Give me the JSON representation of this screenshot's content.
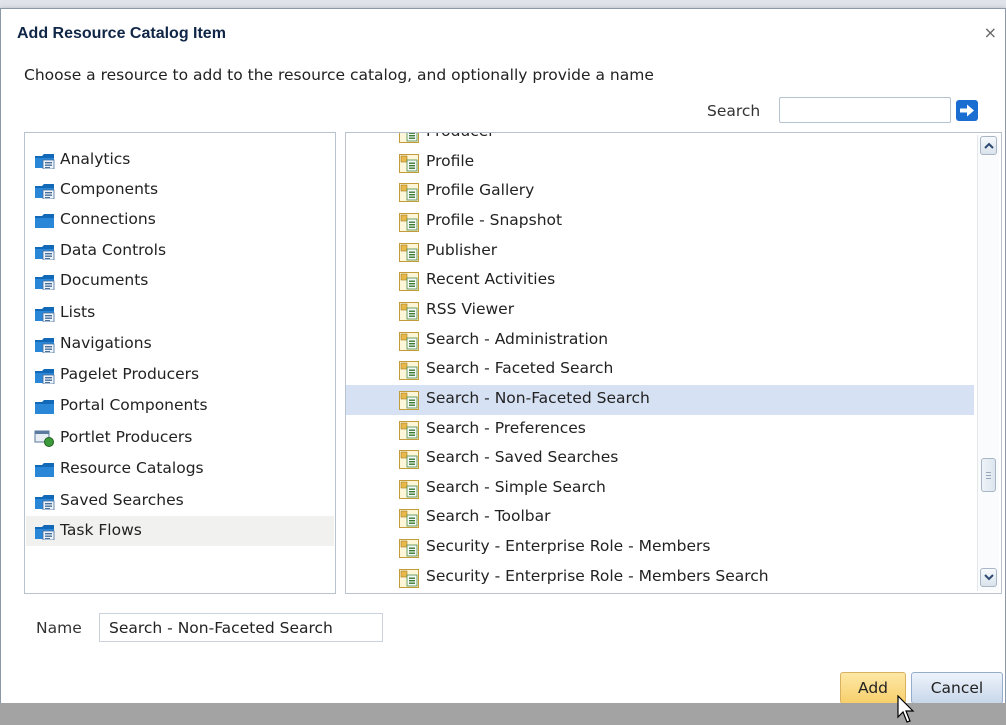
{
  "dialog": {
    "title": "Add Resource Catalog Item",
    "close_glyph": "×",
    "instructions": "Choose a resource to add to the resource catalog, and optionally provide a name"
  },
  "search": {
    "label": "Search",
    "value": "",
    "go_icon": "arrow-right-icon",
    "go_color": "#1a6dd1"
  },
  "folders": [
    {
      "label": "Analytics",
      "icon": "folder-analytics-icon",
      "selected": false
    },
    {
      "label": "Components",
      "icon": "folder-components-icon",
      "selected": false
    },
    {
      "label": "Connections",
      "icon": "folder-icon",
      "selected": false
    },
    {
      "label": "Data Controls",
      "icon": "folder-data-controls-icon",
      "selected": false
    },
    {
      "label": "Documents",
      "icon": "folder-documents-icon",
      "selected": false
    },
    {
      "label": "Lists",
      "icon": "folder-lists-icon",
      "selected": false
    },
    {
      "label": "Navigations",
      "icon": "folder-navigations-icon",
      "selected": false
    },
    {
      "label": "Pagelet Producers",
      "icon": "folder-pagelet-icon",
      "selected": false
    },
    {
      "label": "Portal Components",
      "icon": "folder-icon",
      "selected": false
    },
    {
      "label": "Portlet Producers",
      "icon": "portlet-producer-icon",
      "selected": false
    },
    {
      "label": "Resource Catalogs",
      "icon": "folder-icon",
      "selected": false
    },
    {
      "label": "Saved Searches",
      "icon": "folder-saved-searches-icon",
      "selected": false
    },
    {
      "label": "Task Flows",
      "icon": "folder-task-flows-icon",
      "selected": true
    }
  ],
  "resources": [
    {
      "label": "Producer",
      "selected": false
    },
    {
      "label": "Profile",
      "selected": false
    },
    {
      "label": "Profile Gallery",
      "selected": false
    },
    {
      "label": "Profile - Snapshot",
      "selected": false
    },
    {
      "label": "Publisher",
      "selected": false
    },
    {
      "label": "Recent Activities",
      "selected": false
    },
    {
      "label": "RSS Viewer",
      "selected": false
    },
    {
      "label": "Search - Administration",
      "selected": false
    },
    {
      "label": "Search - Faceted Search",
      "selected": false
    },
    {
      "label": "Search - Non-Faceted Search",
      "selected": true
    },
    {
      "label": "Search - Preferences",
      "selected": false
    },
    {
      "label": "Search - Saved Searches",
      "selected": false
    },
    {
      "label": "Search - Simple Search",
      "selected": false
    },
    {
      "label": "Search - Toolbar",
      "selected": false
    },
    {
      "label": "Security - Enterprise Role - Members",
      "selected": false
    },
    {
      "label": "Security - Enterprise Role - Members Search",
      "selected": false
    }
  ],
  "resource_icon": "task-flow-icon",
  "name_field": {
    "label": "Name",
    "value": "Search - Non-Faceted Search"
  },
  "buttons": {
    "add": "Add",
    "cancel": "Cancel"
  },
  "colors": {
    "selected_resource": "#d6e2f3",
    "selected_folder": "#f1f1ef",
    "title": "#0f2647"
  }
}
